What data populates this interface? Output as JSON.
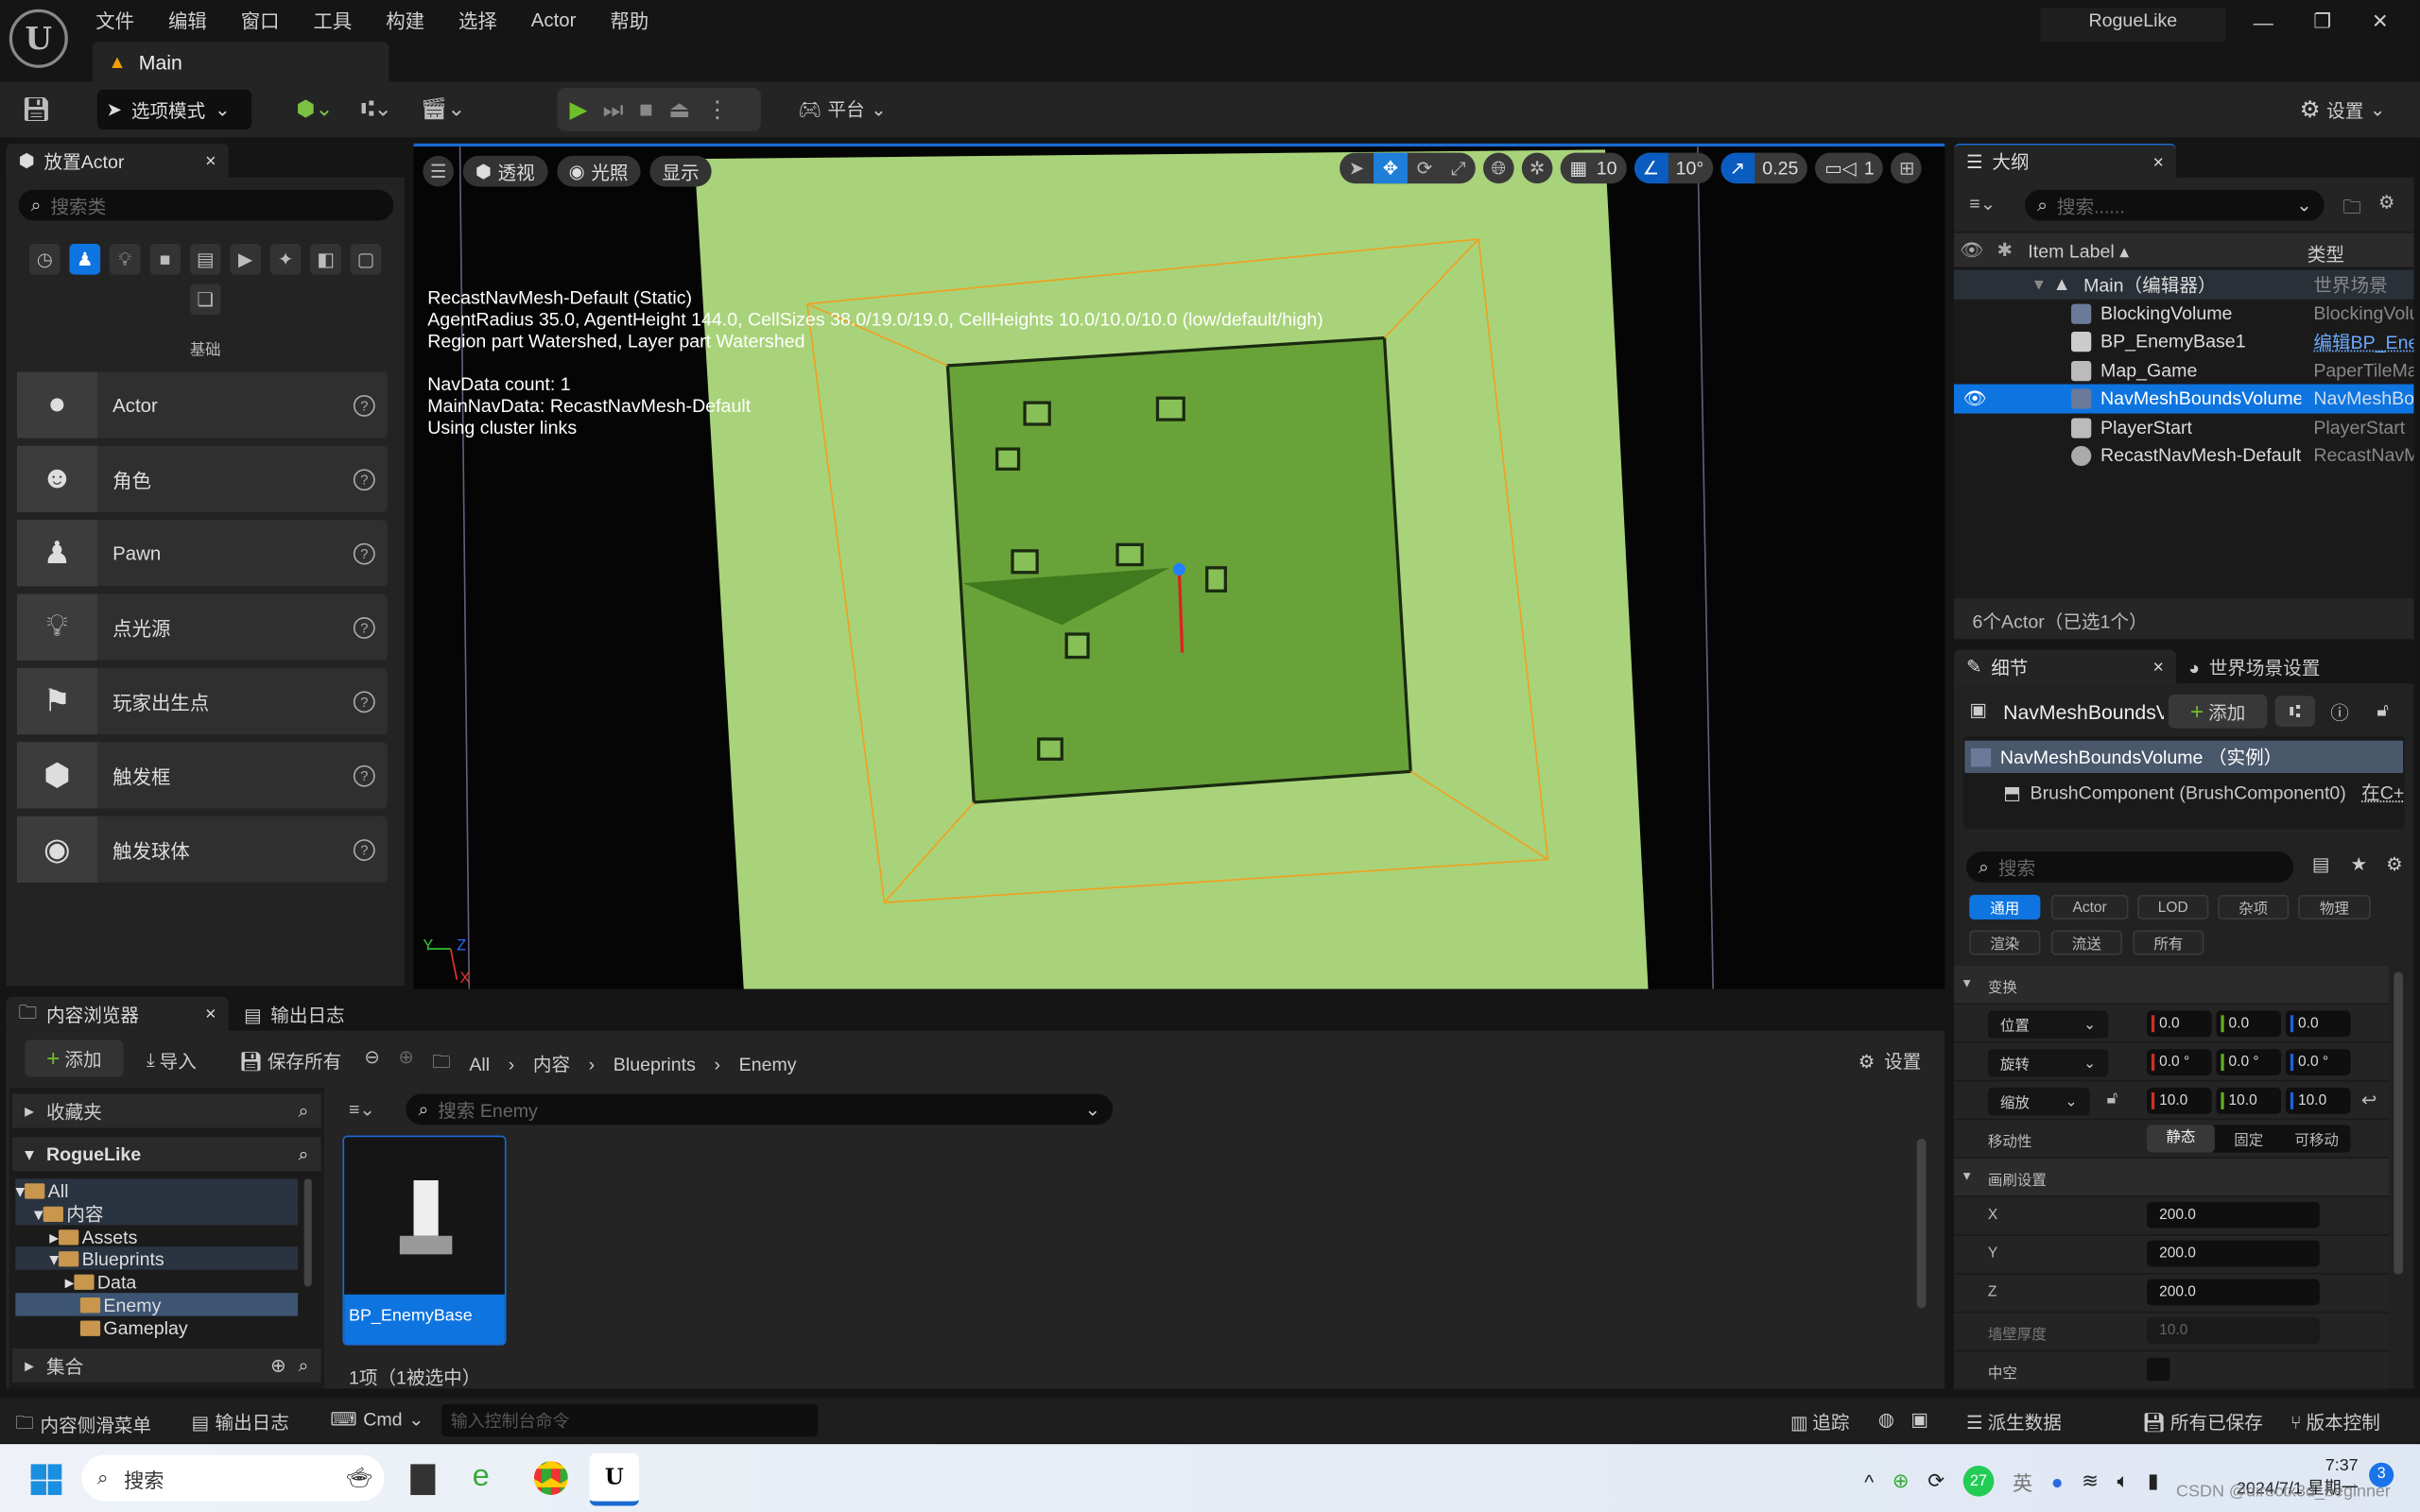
{
  "app": {
    "project_name": "RogueLike",
    "level_tab": "Main"
  },
  "menu": [
    "文件",
    "编辑",
    "窗口",
    "工具",
    "构建",
    "选择",
    "Actor",
    "帮助"
  ],
  "toolbar": {
    "mode": "选项模式",
    "platform": "平台",
    "settings": "设置"
  },
  "place_actors": {
    "tab": "放置Actor",
    "search_placeholder": "搜索类",
    "category": "基础",
    "items": [
      {
        "label": "Actor",
        "icon": "sphere-icon"
      },
      {
        "label": "角色",
        "icon": "character-icon"
      },
      {
        "label": "Pawn",
        "icon": "pawn-icon"
      },
      {
        "label": "点光源",
        "icon": "light-bulb-icon"
      },
      {
        "label": "玩家出生点",
        "icon": "player-start-icon"
      },
      {
        "label": "触发框",
        "icon": "trigger-box-icon"
      },
      {
        "label": "触发球体",
        "icon": "trigger-sphere-icon"
      }
    ]
  },
  "viewport": {
    "buttons": {
      "perspective": "透视",
      "lighting": "光照",
      "show": "显示"
    },
    "grid_snap": "10",
    "rotation_snap": "10°",
    "scale_snap": "0.25",
    "camera_speed": "1",
    "overlay": [
      "RecastNavMesh-Default (Static)",
      "AgentRadius 35.0, AgentHeight 144.0, CellSizes 38.0/19.0/19.0, CellHeights 10.0/10.0/10.0 (low/default/high)",
      "Region part Watershed, Layer part Watershed",
      "",
      "NavData count: 1",
      "MainNavData: RecastNavMesh-Default",
      "Using cluster links"
    ],
    "axis": {
      "y": "Y",
      "z": "Z",
      "x": "X"
    },
    "colors": {
      "floor": "#a9d37a",
      "navmesh": "#6aa23a",
      "bounds": "#f0a020"
    }
  },
  "outliner": {
    "tab": "大纲",
    "search_placeholder": "搜索......",
    "col_label": "Item Label",
    "col_type": "类型",
    "rows": [
      {
        "label": "Main（编辑器）",
        "type": "世界场景"
      },
      {
        "label": "BlockingVolume",
        "type": "BlockingVolume"
      },
      {
        "label": "BP_EnemyBase1",
        "type": "编辑BP_EnemyBase"
      },
      {
        "label": "Map_Game",
        "type": "PaperTileMap"
      },
      {
        "label": "NavMeshBoundsVolume",
        "type": "NavMeshBoundsVolume"
      },
      {
        "label": "PlayerStart",
        "type": "PlayerStart"
      },
      {
        "label": "RecastNavMesh-Default",
        "type": "RecastNavMesh"
      }
    ],
    "status": "6个Actor（已选1个）"
  },
  "details": {
    "tab": "细节",
    "tab2": "世界场景设置",
    "object": "NavMeshBoundsVolume",
    "add": "添加",
    "instance": "NavMeshBoundsVolume （实例）",
    "component": "BrushComponent (BrushComponent0)",
    "component_link": "在C++",
    "search_placeholder": "搜索",
    "categories": [
      "通用",
      "Actor",
      "LOD",
      "杂项",
      "物理",
      "渲染",
      "流送",
      "所有"
    ],
    "transform": {
      "header": "变换",
      "location": "位置",
      "rotation": "旋转",
      "scale": "缩放",
      "loc": [
        "0.0",
        "0.0",
        "0.0"
      ],
      "rot": [
        "0.0 °",
        "0.0 °",
        "0.0 °"
      ],
      "scl": [
        "10.0",
        "10.0",
        "10.0"
      ],
      "mobility": "移动性",
      "mobility_opts": [
        "静态",
        "固定",
        "可移动"
      ]
    },
    "brush": {
      "header": "画刷设置",
      "x_label": "X",
      "x": "200.0",
      "y_label": "Y",
      "y": "200.0",
      "z_label": "Z",
      "z": "200.0",
      "wall_label": "墙壁厚度",
      "wall": "10.0",
      "hollow_label": "中空"
    }
  },
  "content_browser": {
    "tab": "内容浏览器",
    "tab2": "输出日志",
    "add": "添加",
    "import": "导入",
    "save_all": "保存所有",
    "breadcrumb": [
      "All",
      "内容",
      "Blueprints",
      "Enemy"
    ],
    "settings": "设置",
    "favorites": "收藏夹",
    "project": "RogueLike",
    "collections": "集合",
    "tree": [
      {
        "label": "All",
        "depth": 0
      },
      {
        "label": "内容",
        "depth": 1
      },
      {
        "label": "Assets",
        "depth": 2
      },
      {
        "label": "Blueprints",
        "depth": 2
      },
      {
        "label": "Data",
        "depth": 3
      },
      {
        "label": "Enemy",
        "depth": 3
      },
      {
        "label": "Gameplay",
        "depth": 3
      }
    ],
    "search_placeholder": "搜索 Enemy",
    "asset": "BP_EnemyBase",
    "status": "1项（1被选中）"
  },
  "statusbar": {
    "drawer": "内容侧滑菜单",
    "log": "输出日志",
    "cmd": "Cmd",
    "cmd_placeholder": "输入控制台命令",
    "trace": "追踪",
    "derived": "派生数据",
    "saved": "所有已保存",
    "vcs": "版本控制"
  },
  "taskbar": {
    "search": "搜索",
    "time": "7:37",
    "date": "2024/7/1 星期一",
    "badge": "3",
    "ime": "英",
    "tray_count": "27",
    "watermark": "CSDN @directx3d_beginner"
  }
}
